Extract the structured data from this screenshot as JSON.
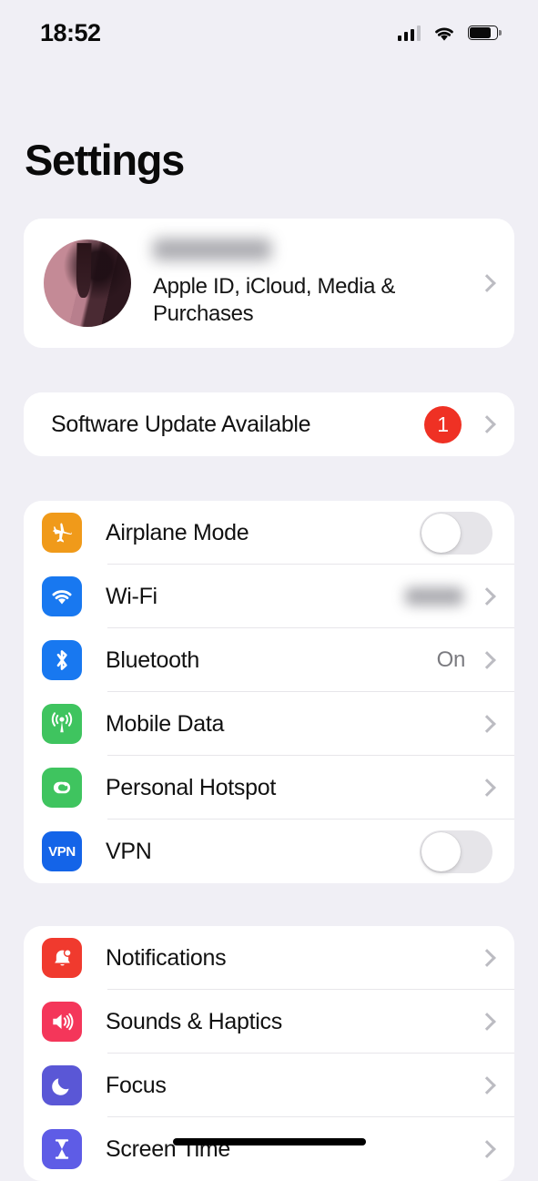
{
  "status_bar": {
    "time": "18:52",
    "signal_icon": "cellular-bars-icon",
    "signal_bars_filled": 3,
    "signal_bars_total": 4,
    "wifi_icon": "wifi-icon",
    "battery_icon": "battery-icon",
    "battery_level_percent": 75
  },
  "header": {
    "title": "Settings"
  },
  "account": {
    "name": "",
    "name_redacted": true,
    "subtitle": "Apple ID, iCloud, Media & Purchases",
    "avatar": "avatar",
    "chevron_icon": "chevron-right-icon"
  },
  "update": {
    "label": "Software Update Available",
    "badge": "1",
    "badge_color": "#ef3124",
    "chevron_icon": "chevron-right-icon"
  },
  "sections": [
    {
      "name": "connectivity",
      "rows": [
        {
          "label": "Airplane Mode",
          "icon": "airplane-icon",
          "icon_color": "#f09a1a",
          "accessory": "toggle",
          "toggle_on": false
        },
        {
          "label": "Wi-Fi",
          "icon": "wifi-icon",
          "icon_color": "#1878f0",
          "accessory": "redacted-value",
          "value": "",
          "value_redacted": true
        },
        {
          "label": "Bluetooth",
          "icon": "bluetooth-icon",
          "icon_color": "#1878f0",
          "accessory": "value",
          "value": "On"
        },
        {
          "label": "Mobile Data",
          "icon": "cellular-antenna-icon",
          "icon_color": "#3fc45f",
          "accessory": "chevron"
        },
        {
          "label": "Personal Hotspot",
          "icon": "hotspot-link-icon",
          "icon_color": "#3fc45f",
          "accessory": "chevron"
        },
        {
          "label": "VPN",
          "icon": "vpn-icon",
          "icon_color": "#1464e8",
          "accessory": "toggle",
          "toggle_on": false
        }
      ]
    },
    {
      "name": "system",
      "rows": [
        {
          "label": "Notifications",
          "icon": "notification-bell-icon",
          "icon_color": "#f03a2e",
          "accessory": "chevron"
        },
        {
          "label": "Sounds & Haptics",
          "icon": "speaker-waves-icon",
          "icon_color": "#f4365a",
          "accessory": "chevron"
        },
        {
          "label": "Focus",
          "icon": "crescent-moon-icon",
          "icon_color": "#5a57d6",
          "accessory": "chevron"
        },
        {
          "label": "Screen Time",
          "icon": "hourglass-icon",
          "icon_color": "#5e5ce6",
          "accessory": "chevron"
        }
      ]
    }
  ],
  "home_indicator": "home-indicator"
}
